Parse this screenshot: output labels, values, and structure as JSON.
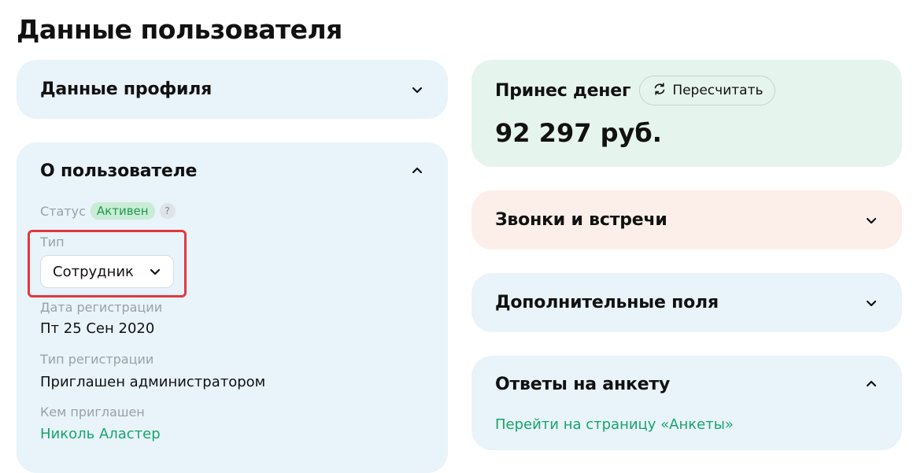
{
  "page": {
    "title": "Данные пользователя"
  },
  "profile_card": {
    "title": "Данные профиля",
    "icon": "chevron-down-icon"
  },
  "about_card": {
    "title": "О пользователе",
    "icon": "chevron-up-icon",
    "status_label": "Статус",
    "status_value": "Активен",
    "status_help": "?",
    "type_label": "Тип",
    "type_value": "Сотрудник",
    "reg_date_label": "Дата регистрации",
    "reg_date_value": "Пт 25 Сен 2020",
    "reg_type_label": "Тип регистрации",
    "reg_type_value": "Приглашен администратором",
    "invited_by_label": "Кем приглашен",
    "invited_by_value": "Николь Аластер"
  },
  "money_card": {
    "title": "Принес денег",
    "recalc_label": "Пересчитать",
    "recalc_icon": "refresh-icon",
    "value": "92 297 руб."
  },
  "calls_card": {
    "title": "Звонки и встречи",
    "icon": "chevron-down-icon"
  },
  "extra_card": {
    "title": "Дополнительные поля",
    "icon": "chevron-down-icon"
  },
  "survey_card": {
    "title": "Ответы на анкету",
    "icon": "chevron-up-icon",
    "link_label": "Перейти на страницу «Анкеты»"
  },
  "colors": {
    "card_blue": "#e8f3fa",
    "card_green": "#e6f4ee",
    "card_peach": "#fcefe9",
    "accent_green": "#19a468",
    "highlight_red": "#e0393e"
  }
}
